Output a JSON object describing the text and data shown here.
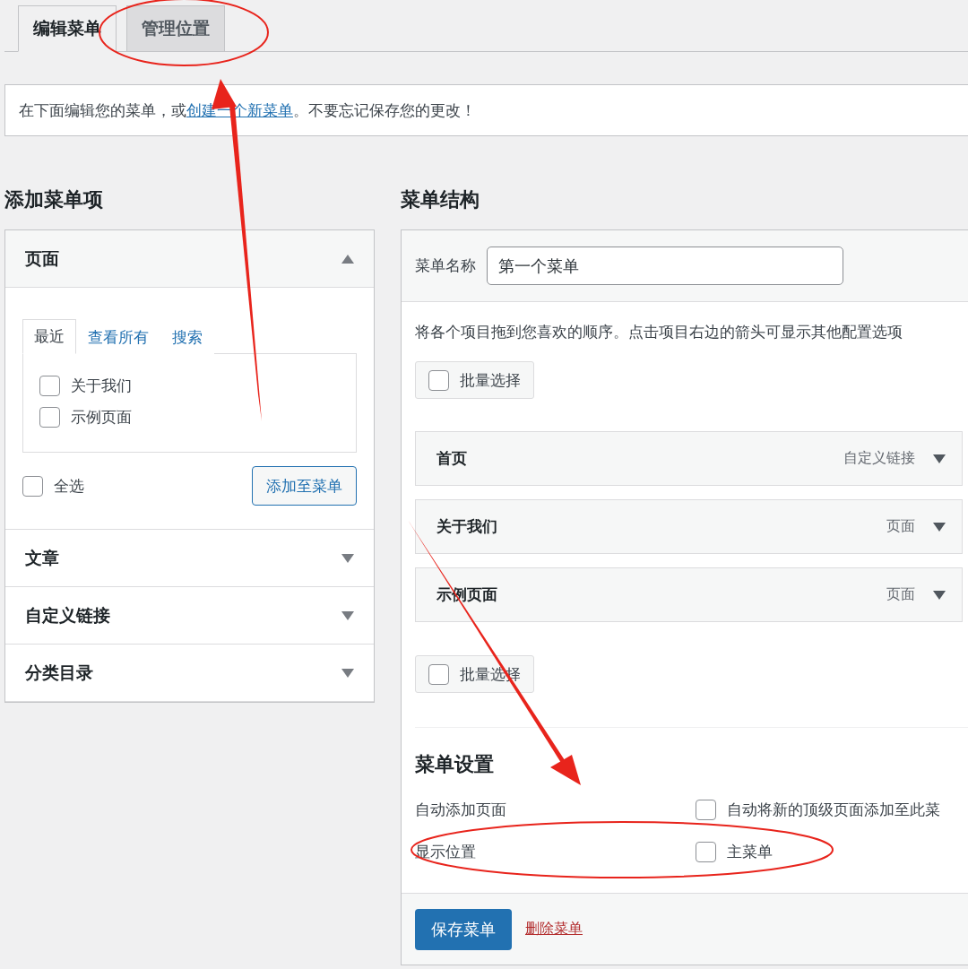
{
  "tabs": [
    {
      "label": "编辑菜单",
      "selected": true
    },
    {
      "label": "管理位置",
      "selected": false
    }
  ],
  "notice": {
    "before": "在下面编辑您的菜单，或",
    "link": "创建一个新菜单",
    "after": "。不要忘记保存您的更改！"
  },
  "add_items": {
    "title": "添加菜单项",
    "sections": [
      {
        "title": "页面",
        "expanded": true,
        "tabs": [
          {
            "label": "最近",
            "selected": true
          },
          {
            "label": "查看所有",
            "selected": false
          },
          {
            "label": "搜索",
            "selected": false
          }
        ],
        "items": [
          {
            "label": "关于我们",
            "checked": false
          },
          {
            "label": "示例页面",
            "checked": false
          }
        ],
        "select_all": {
          "label": "全选",
          "checked": false
        },
        "button": "添加至菜单"
      },
      {
        "title": "文章",
        "expanded": false
      },
      {
        "title": "自定义链接",
        "expanded": false
      },
      {
        "title": "分类目录",
        "expanded": false
      }
    ]
  },
  "structure": {
    "title": "菜单结构",
    "name_label": "菜单名称",
    "name_value": "第一个菜单",
    "instructions": "将各个项目拖到您喜欢的顺序。点击项目右边的箭头可显示其他配置选项",
    "bulk_top": {
      "label": "批量选择",
      "checked": false
    },
    "items": [
      {
        "title": "首页",
        "type": "自定义链接"
      },
      {
        "title": "关于我们",
        "type": "页面"
      },
      {
        "title": "示例页面",
        "type": "页面"
      }
    ],
    "bulk_bottom": {
      "label": "批量选择",
      "checked": false
    },
    "settings": {
      "title": "菜单设置",
      "rows": [
        {
          "label": "自动添加页面",
          "option": "自动将新的顶级页面添加至此菜",
          "checked": false
        },
        {
          "label": "显示位置",
          "option": "主菜单",
          "checked": false
        }
      ]
    },
    "save": "保存菜单",
    "delete": "删除菜单"
  }
}
